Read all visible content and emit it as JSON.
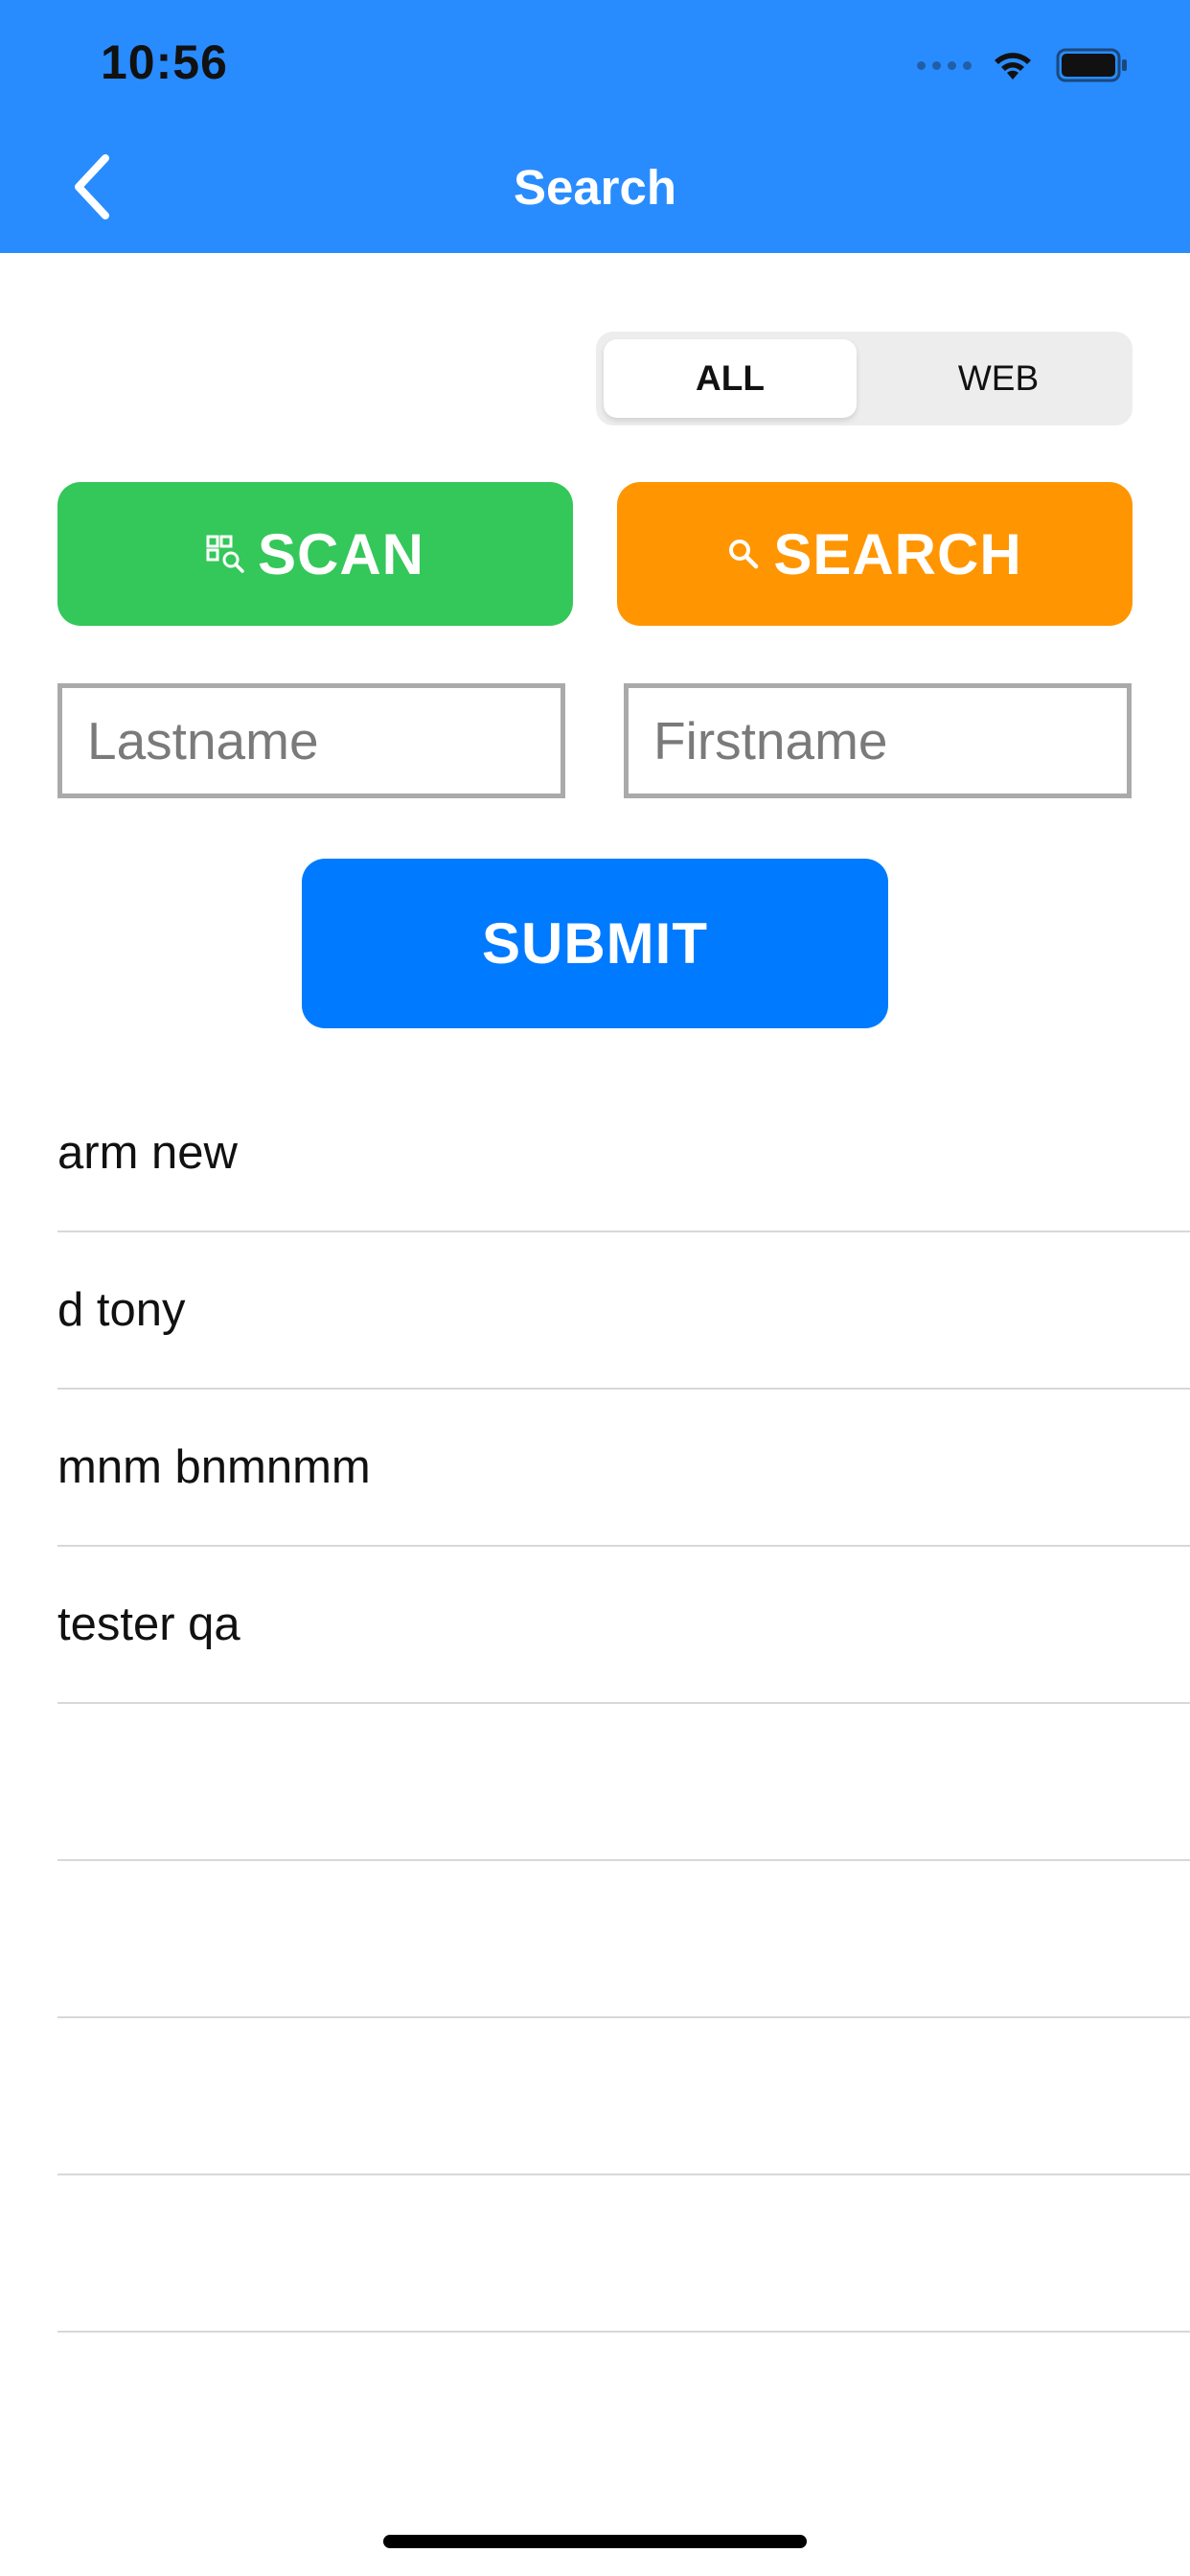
{
  "status_bar": {
    "time": "10:56"
  },
  "header": {
    "title": "Search",
    "back_icon": "chevron-left-icon",
    "background": "#288CFF"
  },
  "segmented_control": {
    "options": [
      "ALL",
      "WEB"
    ],
    "selected": "ALL"
  },
  "actions": {
    "scan_label": "SCAN",
    "scan_icon": "qr-scan-icon",
    "scan_color": "#34C759",
    "search_label": "SEARCH",
    "search_icon": "magnifier-icon",
    "search_color": "#FF9500"
  },
  "form": {
    "lastname_placeholder": "Lastname",
    "lastname_value": "",
    "firstname_placeholder": "Firstname",
    "firstname_value": "",
    "submit_label": "SUBMIT",
    "submit_color": "#007AFF"
  },
  "results": {
    "items": [
      "arm new",
      "d tony",
      "mnm bnmnmm",
      "tester qa",
      "",
      "",
      "",
      ""
    ]
  }
}
